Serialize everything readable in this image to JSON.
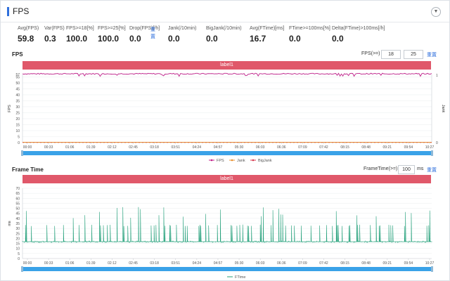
{
  "header": {
    "title": "FPS",
    "collapse_icon": "chevron-down-icon"
  },
  "metrics": [
    {
      "label": "Avg(FPS)",
      "value": "59.8"
    },
    {
      "label": "Var(FPS)",
      "value": "0.3"
    },
    {
      "label": "FPS>=18[%]",
      "value": "100.0"
    },
    {
      "label": "FPS>=25[%]",
      "value": "100.0"
    },
    {
      "label": "Drop(FPS)[/h]",
      "value": "0.0"
    },
    {
      "label": "Jank(/10min)",
      "value": "0.0"
    },
    {
      "label": "BigJank(/10min)",
      "value": "0.0"
    },
    {
      "label": "Avg(FTime)[ms]",
      "value": "16.7"
    },
    {
      "label": "FTime>=100ms[%]",
      "value": "0.0"
    },
    {
      "label": "Delta(FTime)>100ms[/h]",
      "value": "0.0"
    }
  ],
  "metrics_reset": "重置",
  "fps_chart": {
    "title": "FPS",
    "threshold_label": "FPS(>=)",
    "threshold_values": [
      "18",
      "25"
    ],
    "reset_label": "重置",
    "band_label": "label1",
    "colors": {
      "fps": "#c0208a",
      "jank": "#e8902e",
      "bigjank": "#d63a4f",
      "band": "#e0586a",
      "scrollbar": "#3aa2e8"
    }
  },
  "frame_chart": {
    "title": "Frame Time",
    "threshold_label": "FrameTime(>=)",
    "threshold_value": "100",
    "unit": "ms",
    "reset_label": "重置",
    "band_label": "label1",
    "colors": {
      "ftime": "#23a07a"
    }
  },
  "chart_data": [
    {
      "type": "line",
      "title": "FPS",
      "xlabel": "",
      "ylabel": "FPS",
      "y2label": "Jank",
      "x": [
        "00:00",
        "00:33",
        "01:06",
        "01:39",
        "02:12",
        "02:45",
        "03:18",
        "03:51",
        "04:24",
        "04:57",
        "05:30",
        "06:03",
        "06:36",
        "07:09",
        "07:42",
        "08:15",
        "08:48",
        "09:21",
        "09:54",
        "10:27"
      ],
      "yticks": [
        0,
        5,
        10,
        15,
        20,
        25,
        30,
        35,
        40,
        45,
        50,
        55,
        57
      ],
      "ylim": [
        0,
        57
      ],
      "y2ticks": [
        0,
        1
      ],
      "grid": true,
      "legend": "bottom",
      "series": [
        {
          "name": "FPS",
          "baseline": 60,
          "dips": [
            56,
            58
          ]
        },
        {
          "name": "Jank",
          "constant": 0
        },
        {
          "name": "BigJank",
          "constant": 0
        }
      ]
    },
    {
      "type": "line",
      "title": "Frame Time",
      "xlabel": "",
      "ylabel": "ms",
      "x": [
        "00:00",
        "00:33",
        "01:06",
        "01:39",
        "02:12",
        "02:45",
        "03:18",
        "03:51",
        "04:24",
        "04:57",
        "05:30",
        "06:03",
        "06:36",
        "07:09",
        "07:42",
        "08:15",
        "08:48",
        "09:21",
        "09:54",
        "10:27"
      ],
      "yticks": [
        0,
        5,
        10,
        15,
        20,
        25,
        30,
        35,
        40,
        45,
        50,
        55,
        60,
        65,
        70
      ],
      "ylim": [
        0,
        70
      ],
      "grid": true,
      "legend": "bottom",
      "series": [
        {
          "name": "FTime",
          "baseline": 16.7,
          "spikes": [
            33,
            50
          ]
        }
      ]
    }
  ]
}
